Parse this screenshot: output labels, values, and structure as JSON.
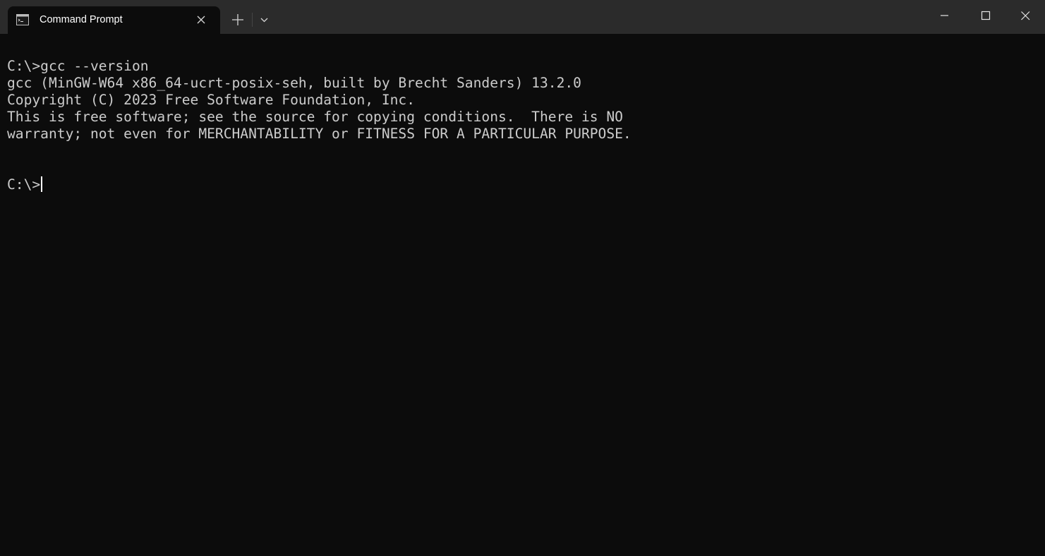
{
  "window": {
    "tab_title": "Command Prompt",
    "tab_icon": "terminal-icon",
    "controls": [
      "minimize-icon",
      "maximize-icon",
      "close-icon"
    ]
  },
  "terminal": {
    "lines": [
      "C:\\>gcc --version",
      "gcc (MinGW-W64 x86_64-ucrt-posix-seh, built by Brecht Sanders) 13.2.0",
      "Copyright (C) 2023 Free Software Foundation, Inc.",
      "This is free software; see the source for copying conditions.  There is NO",
      "warranty; not even for MERCHANTABILITY or FITNESS FOR A PARTICULAR PURPOSE."
    ],
    "prompt": "C:\\>"
  },
  "colors": {
    "titlebar_bg": "#2b2b2b",
    "terminal_bg": "#0c0c0c",
    "text": "#cccccc"
  }
}
